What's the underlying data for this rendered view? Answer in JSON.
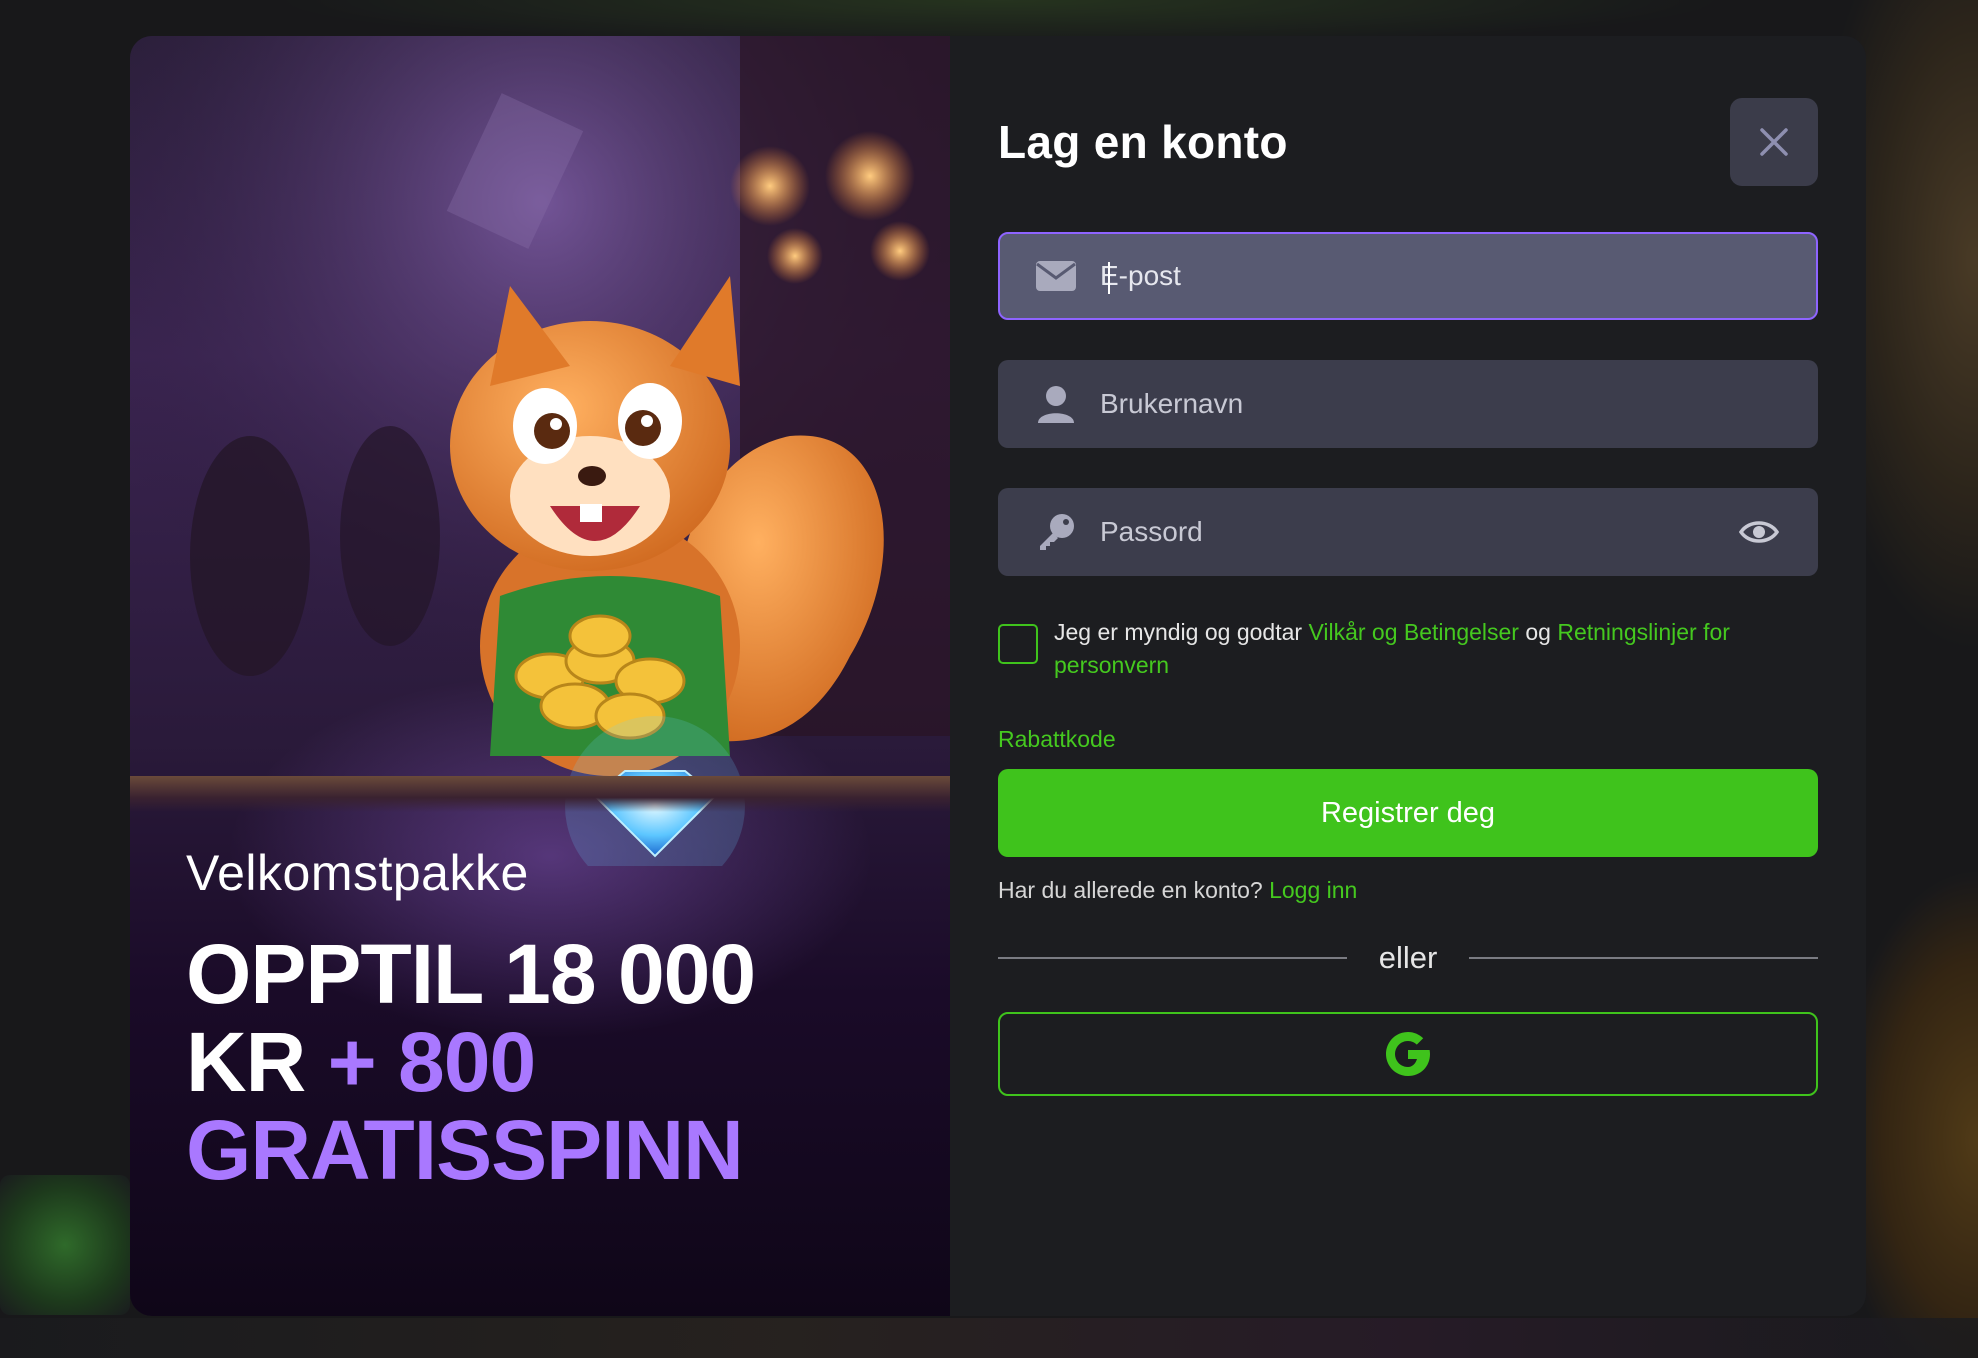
{
  "promo": {
    "subtitle": "Velkomstpakke",
    "headline_line1": "OPPTIL 18 000",
    "headline_line2_white": "KR",
    "headline_line2_purple": " + 800",
    "headline_line3": "GRATISSPINN",
    "accent_color": "#a978ff"
  },
  "form": {
    "title": "Lag en konto",
    "email_placeholder": "E-post",
    "username_placeholder": "Brukernavn",
    "password_placeholder": "Passord",
    "consent_prefix": "Jeg er myndig og godtar ",
    "terms_link": "Vilkår og Betingelser",
    "consent_middle": " og ",
    "privacy_link": "Retningslinjer for personvern",
    "promo_code_link": "Rabattkode",
    "register_label": "Registrer deg",
    "login_prompt": "Har du allerede en konto? ",
    "login_link": "Logg inn",
    "divider_text": "eller",
    "primary_color": "#3fc31c",
    "focus_color": "#8e64ff"
  }
}
